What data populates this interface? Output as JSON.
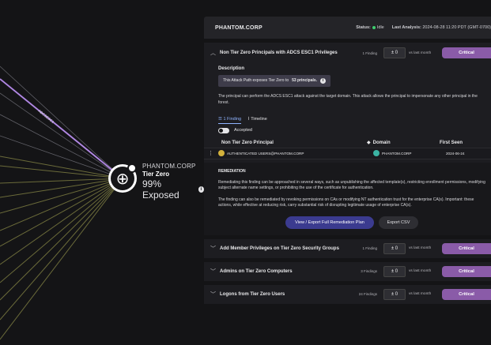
{
  "graph": {
    "node_name": "PHANTOM.CORP",
    "node_tier": "Tier Zero",
    "node_exposure": "99% Exposed",
    "edge_labels": [
      "ADCSESC1"
    ]
  },
  "header": {
    "org": "PHANTOM.CORP",
    "status_label": "Status:",
    "status_value": "Idle",
    "last_label": "Last Analysis:",
    "last_value": "2024-08-28 11:20 PDT (GMT-0700)"
  },
  "expanded": {
    "title": "Non Tier Zero Principals with ADCS ESC1 Privileges",
    "count": "1 Finding",
    "delta": "± 0",
    "vs": "vs last month",
    "severity": "Critical",
    "description_title": "Description",
    "callout_prefix": "This Attack Path exposes Tier Zero to",
    "callout_bold": "53 principals.",
    "description": "The principal can perform the ADCS ESC1 attack against the target domain. This attack allows the principal to impersonate any other principal in the forest.",
    "tab_findings": "☰ 1 Finding",
    "tab_timeline": "⌇ Timeline",
    "accepted_label": "Accepted",
    "table": {
      "headers": [
        "Non Tier Zero Principal",
        "Domain",
        "First Seen"
      ],
      "rows": [
        {
          "principal": "AUTHENTICATED USERS@PHANTOM.CORP",
          "domain": "PHANTOM.CORP",
          "first_seen": "2024-06-24"
        }
      ]
    },
    "remediation_title": "REMEDIATION",
    "remediation_p1": "Remediating this finding can be approached in several ways, such as unpublishing the affected template(s), restricting enrollment permissions, modifying subject alternate name settings, or prohibiting the use of the certificate for authentication.",
    "remediation_p2": "The finding can also be remediated by revoking permissions on CAs or modifying NT authentication trust for the enterprise CA(s). Important: these actions, while effective at reducing risk, carry substantial risk of disrupting legitimate usage of enterprise CA(s).",
    "btn_view": "View / Export Full Remediation Plan",
    "btn_csv": "Export CSV"
  },
  "collapsed": [
    {
      "title": "Add Member Privileges on Tier Zero Security Groups",
      "count": "1 Finding",
      "delta": "± 0",
      "vs": "vs last month",
      "severity": "Critical"
    },
    {
      "title": "Admins on Tier Zero Computers",
      "count": "3 Findings",
      "delta": "± 0",
      "vs": "vs last month",
      "severity": "Critical"
    },
    {
      "title": "Logons from Tier Zero Users",
      "count": "24 Findings",
      "delta": "± 0",
      "vs": "vs last month",
      "severity": "Critical"
    }
  ],
  "colors": {
    "accent": "#8a5ba8",
    "primary_button": "#3b3b8f",
    "status_green": "#3fcf6f",
    "tab_blue": "#8fb3ff"
  }
}
